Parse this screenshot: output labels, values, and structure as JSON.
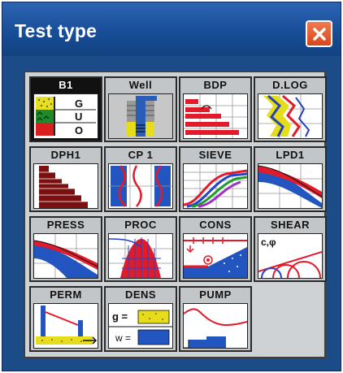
{
  "window": {
    "title": "Test type",
    "close_icon": "close-icon",
    "close_color": "#e05a2a",
    "title_bar_color": "#1a4f96",
    "body_color": "#1b4c88"
  },
  "tiles": [
    {
      "label": "B1",
      "art_text": [
        "G",
        "U",
        "O"
      ],
      "selected": true
    },
    {
      "label": "Well",
      "selected": false
    },
    {
      "label": "BDP",
      "selected": false
    },
    {
      "label": "D.LOG",
      "selected": false
    },
    {
      "label": "DPH1",
      "selected": false
    },
    {
      "label": "CP 1",
      "selected": false
    },
    {
      "label": "SIEVE",
      "selected": false
    },
    {
      "label": "LPD1",
      "selected": false
    },
    {
      "label": "PRESS",
      "selected": false
    },
    {
      "label": "PROC",
      "selected": false
    },
    {
      "label": "CONS",
      "selected": false
    },
    {
      "label": "SHEAR",
      "art_text": [
        "c,φ"
      ],
      "selected": false
    },
    {
      "label": "PERM",
      "selected": false
    },
    {
      "label": "DENS",
      "art_text": [
        "g =",
        "w ="
      ],
      "selected": false
    },
    {
      "label": "PUMP",
      "selected": false
    }
  ]
}
